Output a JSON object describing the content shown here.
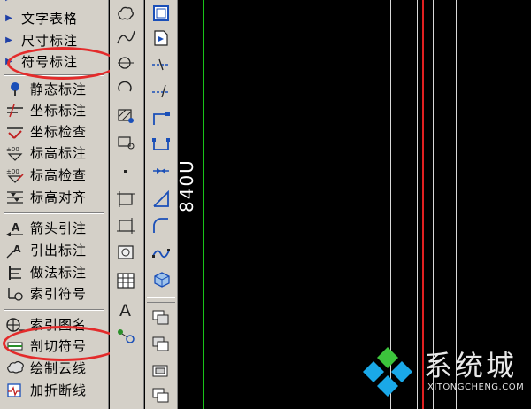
{
  "menu": {
    "items": [
      {
        "label": "文字表格",
        "icon": "triangle-right-icon"
      },
      {
        "label": "尺寸标注",
        "icon": "triangle-right-icon"
      },
      {
        "label": "符号标注",
        "icon": "triangle-right-icon"
      },
      {
        "label": "静态标注",
        "icon": "pin-icon"
      },
      {
        "label": "坐标标注",
        "icon": "coordinate-mark-icon"
      },
      {
        "label": "坐标检查",
        "icon": "coordinate-check-icon"
      },
      {
        "label": "标高标注",
        "icon": "elevation-mark-icon"
      },
      {
        "label": "标高检查",
        "icon": "elevation-check-icon"
      },
      {
        "label": "标高对齐",
        "icon": "elevation-align-icon"
      },
      {
        "label": "箭头引注",
        "icon": "arrow-leader-icon"
      },
      {
        "label": "引出标注",
        "icon": "leader-mark-icon"
      },
      {
        "label": "做法标注",
        "icon": "method-mark-icon"
      },
      {
        "label": "索引符号",
        "icon": "index-symbol-icon"
      },
      {
        "label": "索引图名",
        "icon": "index-title-icon"
      },
      {
        "label": "剖切符号",
        "icon": "section-symbol-icon"
      },
      {
        "label": "绘制云线",
        "icon": "cloud-line-icon"
      },
      {
        "label": "加折断线",
        "icon": "break-line-icon"
      }
    ]
  },
  "canvas": {
    "dimension_text": "840U"
  },
  "watermark": {
    "title": "系统城",
    "subtitle": "XITONGCHENG.COM"
  },
  "colors": {
    "highlight": "#e32b2b",
    "green_line": "#19c219",
    "red_line": "#e02020",
    "white_line": "#d8d8d8",
    "panel": "#d4d0c8",
    "watermark_blue": "#1aa8e8",
    "watermark_green": "#3cc43c"
  }
}
